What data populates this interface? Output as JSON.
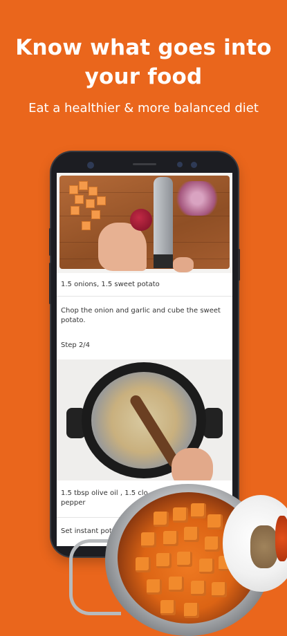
{
  "promo": {
    "headline_line1": "Know what goes into",
    "headline_line2": "your food",
    "subheadline": "Eat a healthier & more balanced diet"
  },
  "recipe_screen": {
    "step1": {
      "ingredients": "1.5 onions, 1.5 sweet potato",
      "instruction": "Chop the onion and garlic and cube the sweet potato."
    },
    "step2": {
      "label": "Step 2/4",
      "ingredients_line1": "1.5 tbsp olive oil , 1.5 clo",
      "ingredients_line2": "pepper",
      "instruction": "Set instant pot"
    }
  },
  "colors": {
    "background": "#ea661c",
    "text_on_background": "#ffffff"
  }
}
